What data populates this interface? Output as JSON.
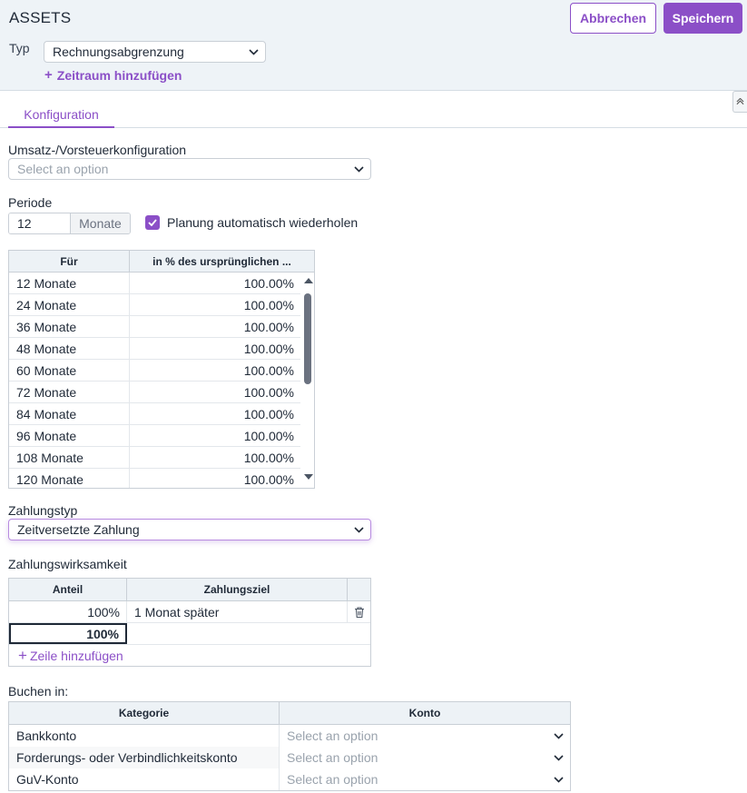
{
  "header": {
    "title": "ASSETS",
    "cancel_label": "Abbrechen",
    "save_label": "Speichern",
    "typ_label": "Typ",
    "typ_value": "Rechnungsabgrenzung",
    "add_period_label": "Zeitraum hinzufügen"
  },
  "tabs": [
    {
      "label": "Konfiguration",
      "active": true
    }
  ],
  "tax": {
    "label": "Umsatz-/Vorsteuerkonfiguration",
    "placeholder": "Select an option"
  },
  "periode": {
    "label": "Periode",
    "value": "12",
    "unit": "Monate",
    "repeat_label": "Planung automatisch wiederholen",
    "repeat_checked": true
  },
  "schedule": {
    "columns": [
      "Für",
      "in % des ursprünglichen ..."
    ],
    "rows": [
      [
        "12 Monate",
        "100.00%"
      ],
      [
        "24 Monate",
        "100.00%"
      ],
      [
        "36 Monate",
        "100.00%"
      ],
      [
        "48 Monate",
        "100.00%"
      ],
      [
        "60 Monate",
        "100.00%"
      ],
      [
        "72 Monate",
        "100.00%"
      ],
      [
        "84 Monate",
        "100.00%"
      ],
      [
        "96 Monate",
        "100.00%"
      ],
      [
        "108 Monate",
        "100.00%"
      ],
      [
        "120 Monate",
        "100.00%"
      ]
    ]
  },
  "payment_type": {
    "label": "Zahlungstyp",
    "value": "Zeitversetzte Zahlung"
  },
  "payment_effect": {
    "label": "Zahlungswirksamkeit",
    "columns": [
      "Anteil",
      "Zahlungsziel"
    ],
    "rows": [
      [
        "100%",
        "1 Monat später"
      ]
    ],
    "total": "100%",
    "add_row_label": "Zeile hinzufügen"
  },
  "booking": {
    "label": "Buchen in:",
    "columns": [
      "Kategorie",
      "Konto"
    ],
    "rows": [
      {
        "category": "Bankkonto",
        "placeholder": "Select an option"
      },
      {
        "category": "Forderungs- oder Verbindlichkeitskonto",
        "placeholder": "Select an option"
      },
      {
        "category": "GuV-Konto",
        "placeholder": "Select an option"
      }
    ]
  },
  "colors": {
    "accent": "#8b4fc7",
    "header_bg": "#eef3f7",
    "grid_header_bg": "#edf2f6"
  }
}
